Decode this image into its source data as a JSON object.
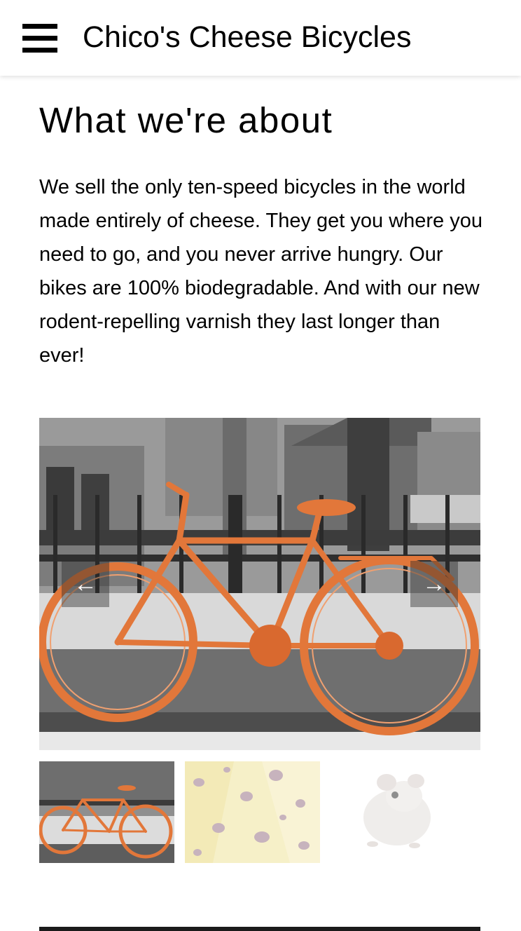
{
  "header": {
    "menu_icon": "hamburger-menu-icon",
    "title": "Chico's Cheese Bicycles"
  },
  "about": {
    "heading": "What we're about",
    "body": "We sell the only ten-speed bicycles in the world made entirely of cheese. They get you where you need to go, and you never arrive hungry. Our bikes are 100% biodegradable. And with our new rodent-repelling varnish they last longer than ever!"
  },
  "carousel": {
    "prev_label": "←",
    "next_label": "→",
    "prev_icon": "arrow-left-icon",
    "next_icon": "arrow-right-icon",
    "slides": [
      {
        "subject": "orange bicycle photo"
      },
      {
        "subject": "swiss cheese photo"
      },
      {
        "subject": "white mouse photo"
      }
    ],
    "active_index": 0
  },
  "colors": {
    "bike_orange": "#e2773a",
    "cheese_yellow": "#f4ecb6",
    "cheese_holes": "#b59aa8",
    "photo_gray": "#8d8d8d"
  }
}
